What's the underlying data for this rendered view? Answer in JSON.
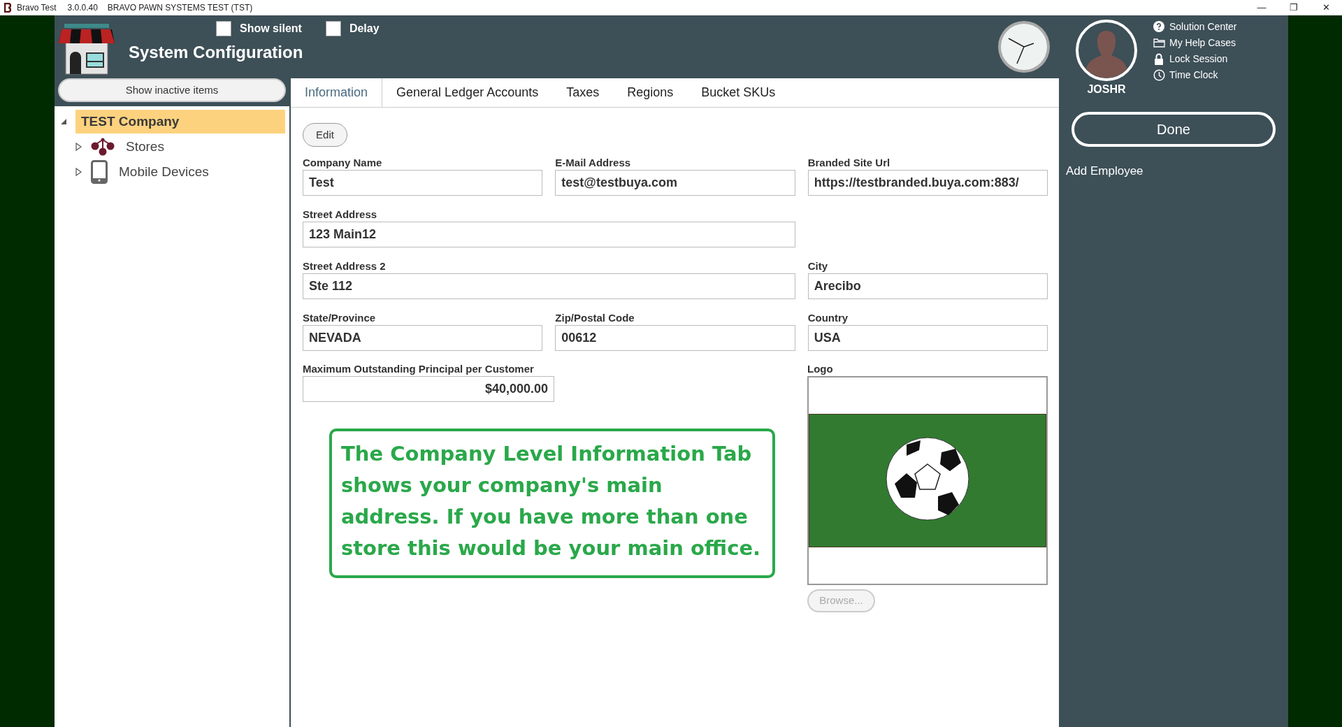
{
  "window": {
    "title": "Bravo Test",
    "version": "3.0.0.40",
    "subtitle": "BRAVO PAWN SYSTEMS TEST (TST)",
    "controls": [
      "—",
      "❐",
      "✕"
    ]
  },
  "header": {
    "title": "System Configuration",
    "toggles": [
      {
        "label": "Show silent",
        "checked": false
      },
      {
        "label": "Delay",
        "checked": false
      }
    ]
  },
  "user": {
    "name": "JOSHR",
    "links": [
      {
        "kind": "help",
        "label": "Solution Center"
      },
      {
        "kind": "folder",
        "label": "My Help Cases"
      },
      {
        "kind": "lock",
        "label": "Lock Session"
      },
      {
        "kind": "clock",
        "label": "Time Clock"
      }
    ]
  },
  "sidebar": {
    "button": "Show inactive items",
    "tree": [
      {
        "label": "TEST Company",
        "selected": true,
        "expanded": true,
        "children": [
          {
            "label": "Stores",
            "kind": "stores",
            "selected": false,
            "expanded": false
          },
          {
            "label": "Mobile Devices",
            "kind": "mobile",
            "selected": false,
            "expanded": false
          }
        ]
      }
    ]
  },
  "tabs": [
    {
      "label": "Information",
      "selected": true
    },
    {
      "label": "General Ledger Accounts",
      "selected": false
    },
    {
      "label": "Taxes",
      "selected": false
    },
    {
      "label": "Regions",
      "selected": false
    },
    {
      "label": "Bucket SKUs",
      "selected": false
    }
  ],
  "edit_button": "Edit",
  "form": [
    {
      "label": "Company Name",
      "value": "Test",
      "kind": "narrow"
    },
    {
      "label": "E-Mail Address",
      "value": "test@testbuya.com",
      "kind": "narrow"
    },
    {
      "label": "Branded Site Url",
      "value": "https://testbranded.buya.com:883/",
      "kind": "narrow"
    },
    {
      "label": "Street Address",
      "value": "123 Main12",
      "kind": "wide"
    },
    {
      "label": "Street Address 2",
      "value": "Ste 112",
      "kind": "wide"
    },
    {
      "label": "City",
      "value": "Arecibo",
      "kind": "narrow"
    },
    {
      "label": "State/Province",
      "value": "NEVADA",
      "kind": "narrow"
    },
    {
      "label": "Zip/Postal Code",
      "value": "00612",
      "kind": "narrow"
    },
    {
      "label": "Country",
      "value": "USA",
      "kind": "narrow"
    }
  ],
  "max_principal": {
    "label": "Maximum Outstanding Principal per Customer",
    "value": "$40,000.00"
  },
  "logo": {
    "label": "Logo",
    "browse": "Browse...",
    "browse_disabled": true
  },
  "callout": "The Company Level Information Tab shows your company's main address. If you have more than one store this would be your main office.",
  "right_panel": {
    "done": "Done",
    "add_employee": "Add Employee"
  }
}
